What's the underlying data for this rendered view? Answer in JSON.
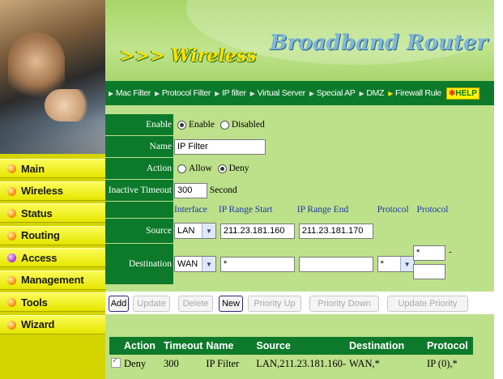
{
  "banner": {
    "title": ">>> Wireless",
    "brand": "Broadband Router"
  },
  "sidebar": {
    "items": [
      {
        "label": "Main",
        "icon": "orange-dot-icon"
      },
      {
        "label": "Wireless",
        "icon": "orange-dot-icon"
      },
      {
        "label": "Status",
        "icon": "orange-dot-icon"
      },
      {
        "label": "Routing",
        "icon": "orange-dot-icon"
      },
      {
        "label": "Access",
        "icon": "purple-dot-icon"
      },
      {
        "label": "Management",
        "icon": "orange-dot-icon"
      },
      {
        "label": "Tools",
        "icon": "orange-dot-icon"
      },
      {
        "label": "Wizard",
        "icon": "orange-dot-icon"
      }
    ]
  },
  "nav": {
    "items": [
      "Mac Filter",
      "Protocol Filter",
      "IP filter",
      "Virtual Server",
      "Special AP",
      "DMZ",
      "Firewall Rule"
    ],
    "help": "HELP"
  },
  "form": {
    "enable_label": "Enable",
    "enable_option": "Enable",
    "disabled_option": "Disabled",
    "name_label": "Name",
    "name_value": "IP Filter",
    "action_label": "Action",
    "allow_option": "Allow",
    "deny_option": "Deny",
    "timeout_label": "Inactive Timeout",
    "timeout_value": "300",
    "timeout_unit": "Second",
    "col_interface": "Interface",
    "col_ip_start": "IP Range Start",
    "col_ip_end": "IP Range End",
    "col_protocol1": "Protocol",
    "col_protocol2": "Protocol",
    "source_label": "Source",
    "source_interface": "LAN",
    "source_ip_start": "211.23.181.160",
    "source_ip_end": "211.23.181.170",
    "destination_label": "Destination",
    "dest_interface": "WAN",
    "dest_ip_start": "*",
    "dest_ip_end": "",
    "dest_protocol": "*",
    "dest_port_start": "*",
    "dest_port_end": "",
    "port_dash": "-"
  },
  "buttons": {
    "add": "Add",
    "update": "Update",
    "delete": "Delete",
    "new": "New",
    "priority_up": "Priority Up",
    "priority_down": "Priority Down",
    "update_priority": "Update Priority"
  },
  "rules": {
    "headers": [
      "Action",
      "Timeout",
      "Name",
      "Source",
      "Destination",
      "Protocol"
    ],
    "row": {
      "action": "Deny",
      "timeout": "300",
      "name": "IP Filter",
      "source": "LAN,211.23.181.160-",
      "destination": "WAN,*",
      "protocol": "IP (0),*"
    }
  },
  "colors": {
    "dark_green": "#0c7a2a",
    "light_green": "#bde08a",
    "sidebar_yellow": "#e6e600",
    "link_blue": "#1a3aa8"
  }
}
